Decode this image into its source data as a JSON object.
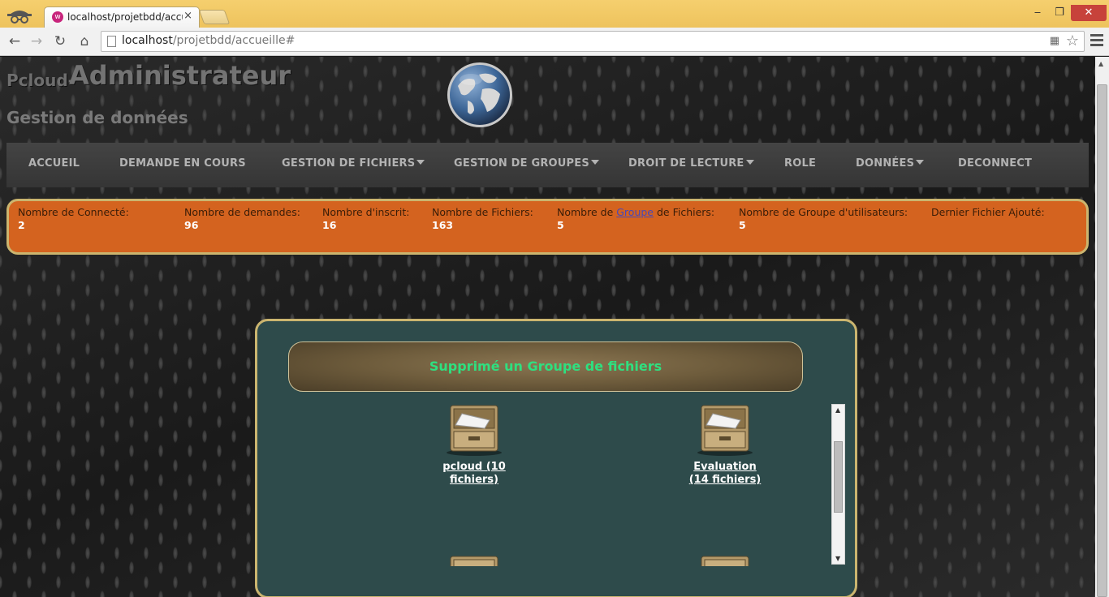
{
  "browser": {
    "tab_title": "localhost/projetbdd/accu",
    "tab_close": "×",
    "url_host": "localhost",
    "url_path": "/projetbdd/accueille#",
    "window_controls": {
      "minimize": "‒",
      "maximize": "❐",
      "close": "✕"
    }
  },
  "header": {
    "logo_small": "Pcloud-",
    "logo_big": "Administrateur",
    "subtitle": "Gestion de données"
  },
  "nav": {
    "items": [
      {
        "label": "ACCUEIL",
        "dropdown": false
      },
      {
        "label": "DEMANDE EN COURS",
        "dropdown": false
      },
      {
        "label": "GESTION DE FICHIERS",
        "dropdown": true
      },
      {
        "label": "GESTION DE GROUPES",
        "dropdown": true
      },
      {
        "label": "DROIT DE LECTURE",
        "dropdown": true
      },
      {
        "label": "ROLE",
        "dropdown": false
      },
      {
        "label": "DONNÉES",
        "dropdown": true
      },
      {
        "label": "DECONNECT",
        "dropdown": false
      }
    ]
  },
  "stats": {
    "connectes": {
      "label": "Nombre de Connecté:",
      "value": "2"
    },
    "demandes": {
      "label": "Nombre de demandes:",
      "value": "96"
    },
    "inscrits": {
      "label": "Nombre d'inscrit:",
      "value": "16"
    },
    "fichiers": {
      "label": "Nombre de Fichiers:",
      "value": "163"
    },
    "groupes_fichiers": {
      "label_before": "Nombre de ",
      "label_link": "Groupe",
      "label_after": " de Fichiers:",
      "value": "5"
    },
    "groupes_utilisateurs": {
      "label": "Nombre de Groupe d'utilisateurs:",
      "value": "5"
    },
    "dernier_fichier": {
      "label": "Dernier Fichier Ajouté:",
      "value": ""
    }
  },
  "panel": {
    "title": "Supprimé un Groupe de fichiers",
    "groups": [
      {
        "label": "pcloud (10 fichiers)"
      },
      {
        "label": "Evaluation (14 fichiers)"
      }
    ]
  },
  "colors": {
    "stats_bg": "#d4631f",
    "border_gold": "#cbb56f",
    "panel_bg": "#2e4b4b",
    "panel_title": "#2ee080"
  }
}
